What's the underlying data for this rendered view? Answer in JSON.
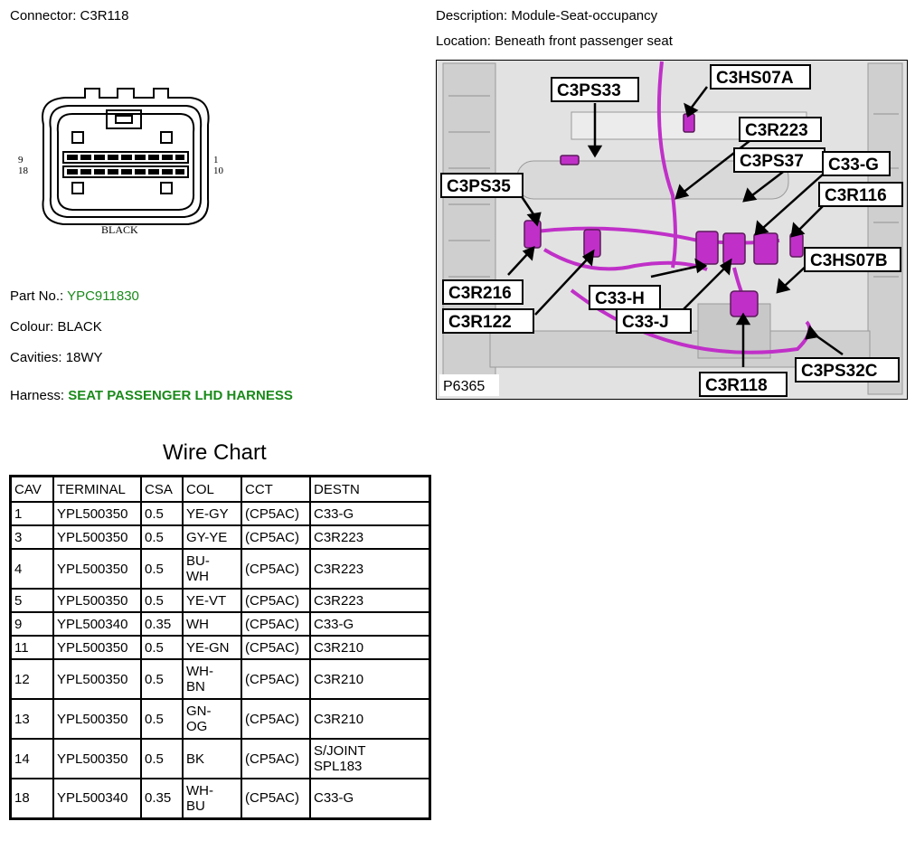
{
  "header": {
    "connector_label": "Connector:",
    "connector_id": "C3R118",
    "description_label": "Description:",
    "description_value": "Module-Seat-occupancy",
    "location_label": "Location:",
    "location_value": "Beneath front passenger seat"
  },
  "connector_face": {
    "left_pins": [
      "9",
      "18"
    ],
    "right_pins": [
      "1",
      "10"
    ],
    "colour_text": "BLACK"
  },
  "details": {
    "part_no_label": "Part No.:",
    "part_no_value": "YPC911830",
    "colour_label": "Colour:",
    "colour_value": "BLACK",
    "cavities_label": "Cavities:",
    "cavities_value": "18WY",
    "harness_label": "Harness:",
    "harness_value": "SEAT PASSENGER LHD HARNESS",
    "link_color": "#1a8a1a"
  },
  "photo": {
    "figure_id": "P6365",
    "callouts": [
      "C3PS33",
      "C3HS07A",
      "C3R223",
      "C3PS37",
      "C33-G",
      "C3PS35",
      "C3R116",
      "C3HS07B",
      "C3R216",
      "C33-H",
      "C3R122",
      "C33-J",
      "C3PS32C",
      "C3R118"
    ],
    "harness_color": "#c030c8"
  },
  "wire_chart": {
    "title": "Wire Chart",
    "columns": [
      "CAV",
      "TERMINAL",
      "CSA",
      "COL",
      "CCT",
      "DESTN"
    ],
    "rows": [
      [
        "1",
        "YPL500350",
        "0.5",
        "YE-GY",
        "(CP5AC)",
        "C33-G"
      ],
      [
        "3",
        "YPL500350",
        "0.5",
        "GY-YE",
        "(CP5AC)",
        "C3R223"
      ],
      [
        "4",
        "YPL500350",
        "0.5",
        "BU-\nWH",
        "(CP5AC)",
        "C3R223"
      ],
      [
        "5",
        "YPL500350",
        "0.5",
        "YE-VT",
        "(CP5AC)",
        "C3R223"
      ],
      [
        "9",
        "YPL500340",
        "0.35",
        "WH",
        "(CP5AC)",
        "C33-G"
      ],
      [
        "11",
        "YPL500350",
        "0.5",
        "YE-GN",
        "(CP5AC)",
        "C3R210"
      ],
      [
        "12",
        "YPL500350",
        "0.5",
        "WH-\nBN",
        "(CP5AC)",
        "C3R210"
      ],
      [
        "13",
        "YPL500350",
        "0.5",
        "GN-\nOG",
        "(CP5AC)",
        "C3R210"
      ],
      [
        "14",
        "YPL500350",
        "0.5",
        "BK",
        "(CP5AC)",
        "S/JOINT\nSPL183"
      ],
      [
        "18",
        "YPL500340",
        "0.35",
        "WH-\nBU",
        "(CP5AC)",
        "C33-G"
      ]
    ]
  }
}
